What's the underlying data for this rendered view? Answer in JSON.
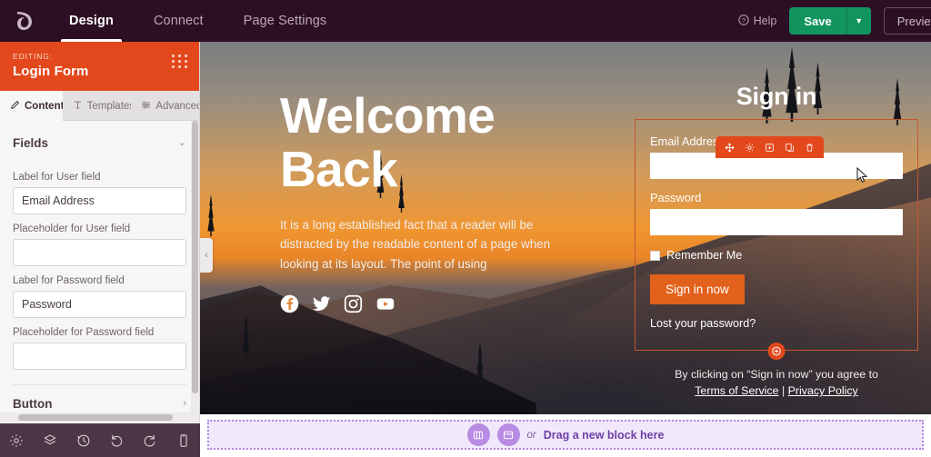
{
  "topbar": {
    "logo_icon": "brand-leaf-icon",
    "nav": [
      {
        "label": "Design",
        "active": true
      },
      {
        "label": "Connect",
        "active": false
      },
      {
        "label": "Page Settings",
        "active": false
      }
    ],
    "help_label": "Help",
    "help_icon": "question-circle-icon",
    "save_label": "Save",
    "save_caret_icon": "chevron-down-icon",
    "preview_label": "Preview"
  },
  "sidebar": {
    "editing_label": "EDITING:",
    "title": "Login Form",
    "grip_icon": "drag-grip-icon",
    "tabs": [
      {
        "label": "Content",
        "icon": "pencil-icon",
        "active": true
      },
      {
        "label": "Templates",
        "icon": "template-icon",
        "active": false
      },
      {
        "label": "Advanced",
        "icon": "sliders-icon",
        "active": false
      }
    ],
    "sections": {
      "fields": {
        "title": "Fields",
        "chevron_icon": "chevron-down-icon",
        "inputs": [
          {
            "label": "Label for User field",
            "value": "Email Address",
            "placeholder": ""
          },
          {
            "label": "Placeholder for User field",
            "value": "",
            "placeholder": ""
          },
          {
            "label": "Label for Password field",
            "value": "Password",
            "placeholder": ""
          },
          {
            "label": "Placeholder for Password field",
            "value": "",
            "placeholder": ""
          }
        ]
      },
      "button": {
        "title": "Button",
        "chevron_icon": "chevron-right-icon"
      }
    },
    "footer_icons": [
      {
        "name": "gear-icon",
        "label": "Settings"
      },
      {
        "name": "layers-icon",
        "label": "Layers"
      },
      {
        "name": "history-icon",
        "label": "History"
      },
      {
        "name": "undo-icon",
        "label": "Undo"
      },
      {
        "name": "redo-icon",
        "label": "Redo"
      },
      {
        "name": "mobile-icon",
        "label": "Responsive"
      }
    ],
    "collapse_icon": "chevron-left-icon"
  },
  "canvas": {
    "hero": {
      "title_line1": "Welcome",
      "title_line2": "Back",
      "paragraph": "It is a long established fact that a reader will be distracted by the readable content of a page when looking at its layout. The point of using",
      "socials": [
        {
          "name": "facebook-icon",
          "label": "Facebook"
        },
        {
          "name": "twitter-icon",
          "label": "Twitter"
        },
        {
          "name": "instagram-icon",
          "label": "Instagram"
        },
        {
          "name": "youtube-icon",
          "label": "YouTube"
        }
      ]
    },
    "login_form": {
      "heading": "Sign in",
      "toolbar_icons": [
        {
          "name": "move-icon",
          "label": "Move"
        },
        {
          "name": "gear-icon",
          "label": "Settings"
        },
        {
          "name": "save-to-library-icon",
          "label": "Save"
        },
        {
          "name": "duplicate-icon",
          "label": "Duplicate"
        },
        {
          "name": "trash-icon",
          "label": "Delete"
        }
      ],
      "email_label": "Email Address",
      "email_value": "",
      "email_placeholder": "",
      "password_label": "Password",
      "password_value": "",
      "password_placeholder": "",
      "remember_label": "Remember Me",
      "remember_checked": false,
      "submit_label": "Sign in now",
      "lost_password_label": "Lost your password?",
      "add_block_icon": "plus-circle-icon",
      "agree_prefix": "By clicking on “Sign in now” you agree to",
      "terms_label": "Terms of Service",
      "agree_separator": "|",
      "privacy_label": "Privacy Policy"
    }
  },
  "dropzone": {
    "column_icon": "columns-icon",
    "block_icon": "block-icon",
    "or_label": "or",
    "text": "Drag a new block here"
  },
  "colors": {
    "topbar_bg": "#2d0f24",
    "accent_orange": "#e2481c",
    "save_green": "#12945f",
    "sidebar_bg": "#f7f6f7",
    "sidebar_foot": "#4c3646",
    "dropzone_purple": "#b488e0",
    "dropzone_bg": "#f1e9fb"
  }
}
